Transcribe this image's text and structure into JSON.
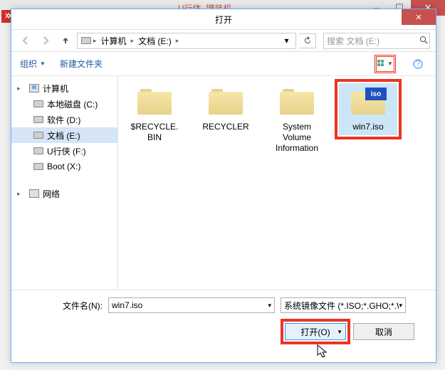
{
  "bg": {
    "title": "U行体_键装机"
  },
  "dialog": {
    "title": "打开"
  },
  "nav": {
    "breadcrumb": {
      "root": "计算机",
      "path": "文档 (E:)"
    },
    "search_placeholder": "搜索 文档 (E:)"
  },
  "toolbar": {
    "organize": "组织",
    "new_folder": "新建文件夹"
  },
  "sidebar": {
    "computer": "计算机",
    "drives": [
      "本地磁盘 (C:)",
      "软件 (D:)",
      "文档 (E:)",
      "U行侠 (F:)",
      "Boot (X:)"
    ],
    "network": "网络"
  },
  "files": [
    {
      "name": "$RECYCLE.BIN",
      "type": "folder"
    },
    {
      "name": "RECYCLER",
      "type": "folder"
    },
    {
      "name": "System Volume Information",
      "type": "folder"
    },
    {
      "name": "win7.iso",
      "type": "iso",
      "selected": true
    }
  ],
  "bottom": {
    "filename_label": "文件名(N):",
    "filename_value": "win7.iso",
    "filter": "系统镜像文件 (*.ISO;*.GHO;*.W",
    "open": "打开(O)",
    "cancel": "取消"
  },
  "iso_badge": "iso"
}
